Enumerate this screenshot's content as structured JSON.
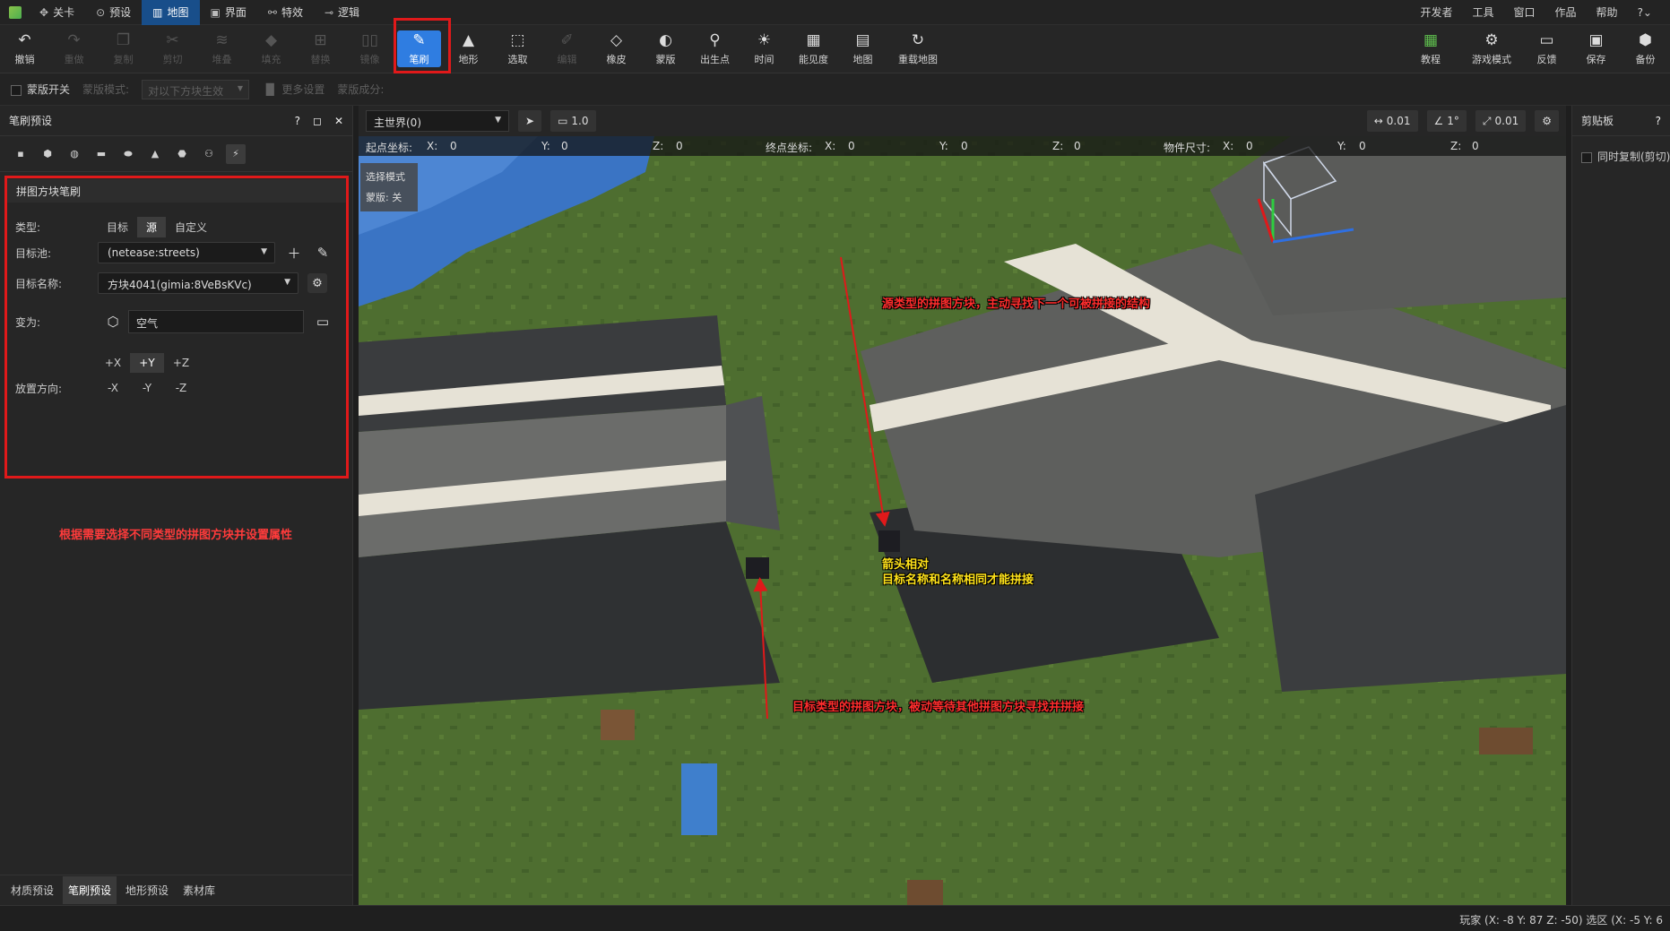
{
  "menubar": {
    "tabs": [
      {
        "icon": "✥",
        "label": "关卡"
      },
      {
        "icon": "⊙",
        "label": "预设"
      },
      {
        "icon": "▥",
        "label": "地图"
      },
      {
        "icon": "▣",
        "label": "界面"
      },
      {
        "icon": "⚯",
        "label": "特效"
      },
      {
        "icon": "⊸",
        "label": "逻辑"
      }
    ],
    "right": [
      "开发者",
      "工具",
      "窗口",
      "作品",
      "帮助",
      "?⌄"
    ]
  },
  "toolbar": {
    "tools": [
      {
        "glyph": "↶",
        "label": "撤销"
      },
      {
        "glyph": "↷",
        "label": "重做"
      },
      {
        "glyph": "❐",
        "label": "复制"
      },
      {
        "glyph": "✂",
        "label": "剪切"
      },
      {
        "glyph": "≋",
        "label": "堆叠"
      },
      {
        "glyph": "◆",
        "label": "填充"
      },
      {
        "glyph": "⊞",
        "label": "替换"
      },
      {
        "glyph": "▯▯",
        "label": "镜像"
      },
      {
        "glyph": "✎",
        "label": "笔刷"
      },
      {
        "glyph": "▲",
        "label": "地形"
      },
      {
        "glyph": "⬚",
        "label": "选取"
      },
      {
        "glyph": "✐",
        "label": "编辑"
      },
      {
        "glyph": "◇",
        "label": "橡皮"
      },
      {
        "glyph": "◐",
        "label": "蒙版"
      },
      {
        "glyph": "⚲",
        "label": "出生点"
      },
      {
        "glyph": "☀",
        "label": "时间"
      },
      {
        "glyph": "▦",
        "label": "能见度"
      },
      {
        "glyph": "▤",
        "label": "地图"
      },
      {
        "glyph": "↻",
        "label": "重载地图"
      }
    ],
    "right_tools": [
      {
        "glyph": "▦",
        "label": "教程"
      },
      {
        "glyph": "⚙",
        "label": "游戏模式"
      },
      {
        "glyph": "▭",
        "label": "反馈"
      },
      {
        "glyph": "▣",
        "label": "保存"
      },
      {
        "glyph": "⬢",
        "label": "备份"
      }
    ]
  },
  "optbar": {
    "mask_toggle": "蒙版开关",
    "mask_mode": "蒙版模式:",
    "mask_select": "对以下方块生效",
    "more": "更多设置",
    "mask_components": "蒙版成分:"
  },
  "leftpanel": {
    "title": "笔刷预设",
    "actions": [
      "?",
      "◻",
      "✕"
    ],
    "shapes": [
      "▪",
      "⬢",
      "◍",
      "▬",
      "⬬",
      "▲",
      "⬣",
      "⚇",
      "⚡"
    ],
    "brush_title": "拼图方块笔刷",
    "type_label": "类型:",
    "type_options": [
      "目标",
      "源",
      "自定义"
    ],
    "pool_label": "目标池:",
    "pool_value": "(netease:streets)",
    "name_label": "目标名称:",
    "name_value": "方块4041(gimia:8VeBsKVc)",
    "turn_label": "变为:",
    "turn_value": "空气",
    "dir_label": "放置方向:",
    "directions_top": [
      "+X",
      "+Y",
      "+Z"
    ],
    "directions_bottom": [
      "-X",
      "-Y",
      "-Z"
    ],
    "note": "根据需要选择不同类型的拼图方块并设置属性",
    "bottom_tabs": [
      "材质预设",
      "笔刷预设",
      "地形预设",
      "素材库"
    ]
  },
  "viewport": {
    "world": "主世界(0)",
    "speed": "1.0",
    "move_step": "0.01",
    "rotate_step": "1°",
    "scale_step": "0.01",
    "coords": {
      "start_label": "起点坐标:",
      "end_label": "终点坐标:",
      "size_label": "物件尺寸:",
      "x": "X:",
      "y": "Y:",
      "z": "Z:",
      "zero": "0"
    },
    "mode_lines": [
      "选择模式",
      "蒙版: 关"
    ],
    "annotations": {
      "source": "源类型的拼图方块，主动寻找下一个可被拼接的结构",
      "arrows_1": "箭头相对",
      "arrows_2": "目标名称和名称相同才能拼接",
      "target": "目标类型的拼图方块，被动等待其他拼图方块寻找并拼接"
    },
    "colors": {
      "grass": "#4e6e30",
      "road_dark": "#3b3d3f",
      "road_light": "#e6e2d6",
      "annot_red": "#ff2d2d",
      "annot_yellow": "#ffe21a"
    }
  },
  "rightpanel": {
    "title": "剪贴板",
    "help": "?",
    "sync_copy": "同时复制(剪切)"
  },
  "statusbar": {
    "text": "玩家 (X: -8  Y: 87  Z: -50) 选区 (X: -5  Y: 6"
  }
}
